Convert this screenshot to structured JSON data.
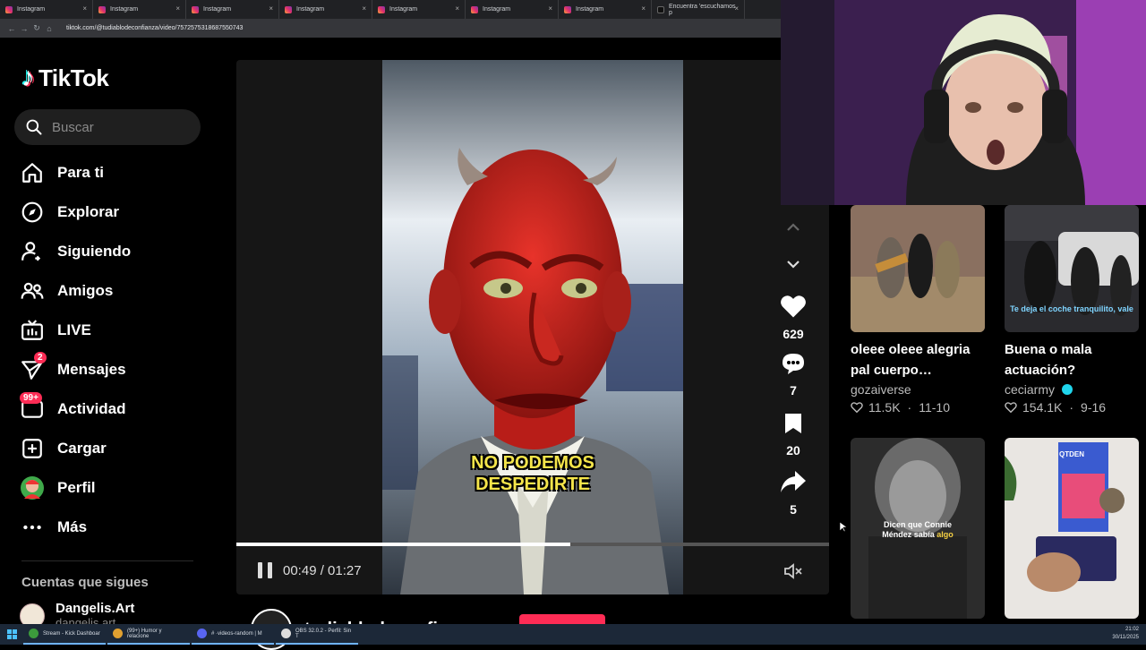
{
  "browser": {
    "tabs": [
      {
        "label": "Instagram",
        "icon": "instagram-icon"
      },
      {
        "label": "Instagram",
        "icon": "instagram-icon"
      },
      {
        "label": "Instagram",
        "icon": "instagram-icon"
      },
      {
        "label": "Instagram",
        "icon": "instagram-icon"
      },
      {
        "label": "Instagram",
        "icon": "instagram-icon"
      },
      {
        "label": "Instagram",
        "icon": "instagram-icon"
      },
      {
        "label": "Instagram",
        "icon": "instagram-icon"
      },
      {
        "label": "Encuentra 'escuchamos p",
        "icon": "tiktok-icon"
      }
    ],
    "url": "tiktok.com/@tudiablodeconfianza/video/7572575318687550743"
  },
  "sidebar": {
    "logo_text": "TikTok",
    "search_placeholder": "Buscar",
    "nav": [
      {
        "label": "Para ti",
        "icon": "home-icon"
      },
      {
        "label": "Explorar",
        "icon": "compass-icon"
      },
      {
        "label": "Siguiendo",
        "icon": "following-icon"
      },
      {
        "label": "Amigos",
        "icon": "friends-icon"
      },
      {
        "label": "LIVE",
        "icon": "live-icon"
      },
      {
        "label": "Mensajes",
        "icon": "messages-icon",
        "badge": "2"
      },
      {
        "label": "Actividad",
        "icon": "activity-icon",
        "badge": "99+"
      },
      {
        "label": "Cargar",
        "icon": "upload-icon"
      },
      {
        "label": "Perfil",
        "icon": "profile-avatar"
      },
      {
        "label": "Más",
        "icon": "more-icon"
      }
    ],
    "following_header": "Cuentas que sigues",
    "following": [
      {
        "name": "Dangelis.Art",
        "handle": "dangelis.art"
      }
    ]
  },
  "video": {
    "subtitle_line1": "NO PODEMOS",
    "subtitle_line2": "DESPEDIRTE",
    "time": "00:49 / 01:27",
    "progress": 0.563,
    "author": "tudiablodeconfianza"
  },
  "actions": {
    "likes": "629",
    "comments": "7",
    "saves": "20",
    "shares": "5"
  },
  "recommended": [
    {
      "title_1": "oleee oleee alegria",
      "title_2": "pal cuerpo…",
      "author": "gozaiverse",
      "likes": "11.5K",
      "date": "11-10",
      "verified": false
    },
    {
      "title_1": "Buena o mala",
      "title_2": "actuación?",
      "author": "ceciarmy",
      "likes": "154.1K",
      "date": "9-16",
      "verified": true,
      "caption": "Te deja el coche tranquilito, vale"
    },
    {
      "caption_1": "Dicen que Connie",
      "caption_2": "Méndez sabía",
      "caption_3": "algo"
    },
    {
      "caption_1": "QTDEN"
    }
  ],
  "taskbar": {
    "apps": [
      {
        "label": "Stream - Kick Dashboar",
        "color": "#3c9b3c"
      },
      {
        "label": "(99+) Humor y relacione",
        "color": "#e0a030"
      },
      {
        "label": "# ·videos-random | M",
        "color": "#5865f2"
      },
      {
        "label": "OBS 32.0.2 - Perfil: Sin T",
        "color": "#ddd"
      }
    ],
    "time": "21:02",
    "date": "30/11/2025"
  }
}
